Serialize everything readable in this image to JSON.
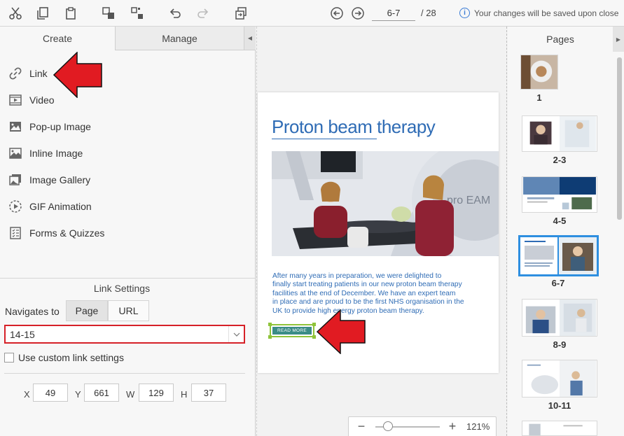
{
  "toolbar": {
    "page_input": "6-7",
    "page_total": "/ 28",
    "save_note": "Your changes will be saved upon close",
    "info_glyph": "i",
    "icons": [
      "cut-icon",
      "copy-icon",
      "paste-icon",
      "group-icon",
      "ungroup-icon",
      "undo-icon",
      "redo-icon",
      "replace-icon",
      "prev-page-icon",
      "next-page-icon",
      "info-icon"
    ]
  },
  "left_panel": {
    "tabs": {
      "create": "Create",
      "manage": "Manage",
      "collapse_glyph": "◀"
    },
    "tools": [
      {
        "label": "Link",
        "icon": "link-icon"
      },
      {
        "label": "Video",
        "icon": "video-icon"
      },
      {
        "label": "Pop-up Image",
        "icon": "popup-image-icon"
      },
      {
        "label": "Inline Image",
        "icon": "inline-image-icon"
      },
      {
        "label": "Image Gallery",
        "icon": "image-gallery-icon"
      },
      {
        "label": "GIF Animation",
        "icon": "gif-animation-icon"
      },
      {
        "label": "Forms & Quizzes",
        "icon": "forms-quizzes-icon"
      }
    ]
  },
  "link_settings": {
    "title": "Link Settings",
    "navigates_to_label": "Navigates to",
    "option_page": "Page",
    "option_url": "URL",
    "selected_option": "Page",
    "destination_value": "14-15",
    "custom_label": "Use custom link settings",
    "custom_checked": false,
    "x_label": "X",
    "x_value": "49",
    "y_label": "Y",
    "y_value": "661",
    "w_label": "W",
    "w_value": "129",
    "h_label": "H",
    "h_value": "37"
  },
  "canvas": {
    "title": "Proton beam therapy",
    "body_lines": [
      "After many years in preparation, we were delighted to",
      "finally start treating patients in our new proton beam therapy",
      "facilities at the end of December. We have an expert team",
      "in place and are proud to be the first NHS organisation in the",
      "UK to provide high energy proton beam therapy."
    ],
    "button_label": "READ MORE",
    "photo_text": "pro  EAM"
  },
  "zoom": {
    "minus": "−",
    "plus": "+",
    "value": "121%",
    "level_fraction": 0.12
  },
  "pages_panel": {
    "title": "Pages",
    "collapse_glyph": "▶",
    "thumbnails": [
      {
        "label": "1"
      },
      {
        "label": "2-3"
      },
      {
        "label": "4-5"
      },
      {
        "label": "6-7",
        "selected": true
      },
      {
        "label": "8-9"
      },
      {
        "label": "10-11"
      }
    ]
  },
  "colors": {
    "accent_red": "#d62128",
    "selection_blue": "#2e8fe0",
    "doc_blue": "#2f6cb5",
    "button_teal": "#3b8c86",
    "handle_green": "#8fc43a"
  }
}
